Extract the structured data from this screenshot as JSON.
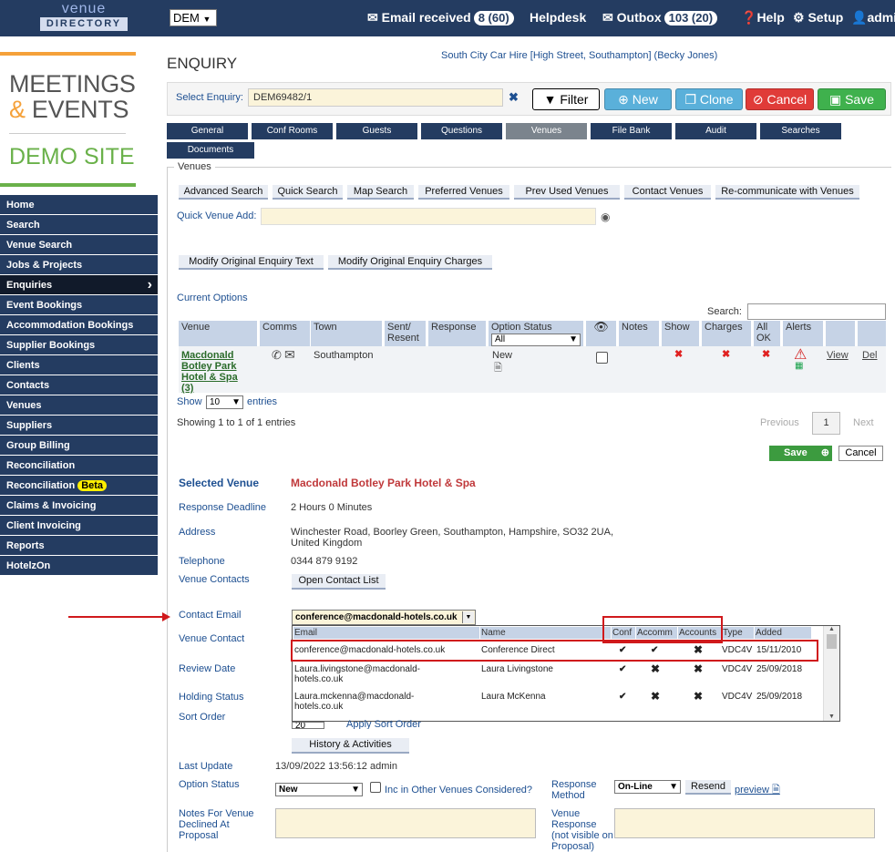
{
  "topbar": {
    "logo_top": "venue",
    "logo_bottom": "DIRECTORY",
    "site_select": "DEM",
    "email_received_label": "Email received",
    "email_received_count": "8 (60)",
    "helpdesk": "Helpdesk",
    "outbox_label": "Outbox",
    "outbox_count": "103 (20)",
    "help": "Help",
    "setup": "Setup",
    "user": "admin"
  },
  "brand": {
    "line1": "MEETINGS",
    "amp": "&",
    "line2": "EVENTS",
    "line3": "DEMO SITE"
  },
  "nav": [
    {
      "label": "Home"
    },
    {
      "label": "Search"
    },
    {
      "label": "Venue Search"
    },
    {
      "label": "Jobs & Projects"
    },
    {
      "label": "Enquiries"
    },
    {
      "label": "Event Bookings"
    },
    {
      "label": "Accommodation Bookings"
    },
    {
      "label": "Supplier Bookings"
    },
    {
      "label": "Clients"
    },
    {
      "label": "Contacts"
    },
    {
      "label": "Venues"
    },
    {
      "label": "Suppliers"
    },
    {
      "label": "Group Billing"
    },
    {
      "label": "Reconciliation"
    },
    {
      "label": "Reconciliation"
    },
    {
      "label": "Claims & Invoicing"
    },
    {
      "label": "Client Invoicing"
    },
    {
      "label": "Reports"
    },
    {
      "label": "HotelzOn"
    }
  ],
  "nav_beta": "Beta",
  "page": {
    "title": "ENQUIRY",
    "agent_line": "South City Car Hire [High Street, Southampton] (Becky Jones)",
    "select_enquiry_label": "Select Enquiry:",
    "select_enquiry_value": "DEM69482/1",
    "clear": "✖",
    "filter": "Filter",
    "new": "New",
    "clone": "Clone",
    "cancel": "Cancel",
    "save": "Save"
  },
  "tabs": [
    "General",
    "Conf Rooms",
    "Guests",
    "Questions",
    "Venues",
    "File Bank",
    "Audit",
    "Searches",
    "Documents"
  ],
  "venues": {
    "legend": "Venues",
    "search_buttons": [
      "Advanced Search",
      "Quick Search",
      "Map Search",
      "Preferred Venues",
      "Prev Used Venues",
      "Contact Venues",
      "Re-communicate with Venues"
    ],
    "quick_add_label": "Quick Venue Add:",
    "modify_text": "Modify Original Enquiry Text",
    "modify_charges": "Modify Original Enquiry Charges",
    "current_options": "Current Options",
    "search_label": "Search:"
  },
  "options_table": {
    "headers": [
      "Venue",
      "Comms",
      "Town",
      "Sent/ Resent",
      "Response",
      "Option Status",
      "Notes",
      "Show",
      "Charges",
      "All OK",
      "Alerts"
    ],
    "status_filter": "All",
    "row": {
      "venue": "Macdonald Botley Park Hotel & Spa (3)",
      "town": "Southampton",
      "status": "New",
      "view": "View",
      "del": "Del"
    },
    "show_label": "Show",
    "show_value": "10",
    "entries_label": "entries",
    "showing": "Showing 1 to 1 of 1 entries",
    "previous": "Previous",
    "page": "1",
    "next": "Next",
    "save": "Save",
    "cancel": "Cancel"
  },
  "selected": {
    "selected_venue_label": "Selected Venue",
    "selected_venue_value": "Macdonald Botley Park Hotel & Spa",
    "deadline_label": "Response Deadline",
    "deadline_value": "2 Hours 0 Minutes",
    "address_label": "Address",
    "address_line1": "Winchester Road, Boorley Green, Southampton, Hampshire, SO32 2UA,",
    "address_line2": "United Kingdom",
    "telephone_label": "Telephone",
    "telephone_value": "0344 879 9192",
    "venue_contacts_label": "Venue Contacts",
    "open_contact_list": "Open Contact List",
    "contact_email_label": "Contact Email",
    "contact_email_value": "conference@macdonald-hotels.co.uk",
    "venue_contact_label": "Venue Contact",
    "review_date_label": "Review Date",
    "holding_status_label": "Holding Status",
    "sort_order_label": "Sort Order",
    "sort_order_value": "20",
    "apply_sort": "Apply Sort Order",
    "history": "History & Activities",
    "last_update_label": "Last Update",
    "last_update_value": "13/09/2022 13:56:12 admin",
    "option_status_label": "Option Status",
    "option_status_value": "New",
    "inc_other": "Inc in Other Venues Considered?",
    "response_method_label": "Response Method",
    "response_method_value": "On-Line",
    "resend": "Resend",
    "preview": "preview",
    "notes_label": "Notes For Venue Declined At Proposal",
    "venue_response_label": "Venue Response (not visible on Proposal)"
  },
  "email_grid": {
    "headers": [
      "Email",
      "Name",
      "Conf",
      "Accomm",
      "Accounts",
      "Type",
      "Added"
    ],
    "rows": [
      {
        "email": "conference@macdonald-hotels.co.uk",
        "name": "Conference Direct",
        "conf": "✔",
        "accomm": "✔",
        "accounts": "✖",
        "type": "VDC4V",
        "added": "15/11/2010"
      },
      {
        "email": "Laura.livingstone@macdonald-hotels.co.uk",
        "name": "Laura Livingstone",
        "conf": "✔",
        "accomm": "✖",
        "accounts": "✖",
        "type": "VDC4V",
        "added": "25/09/2018"
      },
      {
        "email": "Laura.mckenna@macdonald-hotels.co.uk",
        "name": "Laura McKenna",
        "conf": "✔",
        "accomm": "✖",
        "accounts": "✖",
        "type": "VDC4V",
        "added": "25/09/2018"
      }
    ]
  }
}
